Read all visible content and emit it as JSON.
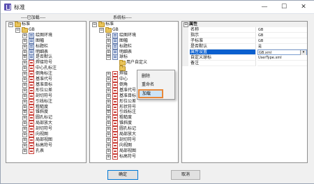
{
  "window": {
    "title": "标准",
    "min": "—",
    "max": "☐",
    "close": "✕"
  },
  "sections": {
    "loaded": "----已加载----",
    "system": "系统标----"
  },
  "loaded_tree": [
    {
      "label": "标准",
      "expander": "⊟",
      "icon": "folder"
    },
    {
      "label": "GB",
      "expander": "⊟",
      "icon": "folder"
    },
    {
      "label": "绘图环境",
      "expander": "⊞",
      "icon": "std"
    },
    {
      "label": "图幅",
      "expander": "⊞",
      "icon": "std"
    },
    {
      "label": "标题栏",
      "expander": "⊞",
      "icon": "std"
    },
    {
      "label": "明细表",
      "expander": "⊞",
      "icon": "std"
    },
    {
      "label": "是否默认",
      "expander": "⊞",
      "icon": "std"
    },
    {
      "label": "焊接符号",
      "expander": "⊞",
      "icon": "red"
    },
    {
      "label": "中心孔标注",
      "expander": "⊞",
      "icon": "red"
    },
    {
      "label": "倒角标注",
      "expander": "⊞",
      "icon": "red"
    },
    {
      "label": "基准代号",
      "expander": "⊞",
      "icon": "red"
    },
    {
      "label": "基准目标",
      "expander": "⊞",
      "icon": "red"
    },
    {
      "label": "形位公差",
      "expander": "⊞",
      "icon": "red"
    },
    {
      "label": "剖切符号",
      "expander": "⊞",
      "icon": "red"
    },
    {
      "label": "引线标注",
      "expander": "⊞",
      "icon": "red"
    },
    {
      "label": "粗糙度",
      "expander": "⊞",
      "icon": "red"
    },
    {
      "label": "锥斜度",
      "expander": "⊞",
      "icon": "red"
    },
    {
      "label": "圆孔标记",
      "expander": "⊞",
      "icon": "red"
    },
    {
      "label": "局部放大",
      "expander": "⊞",
      "icon": "red"
    },
    {
      "label": "剖切符号",
      "expander": "⊞",
      "icon": "red"
    },
    {
      "label": "向视图",
      "expander": "⊞",
      "icon": "red"
    },
    {
      "label": "局部视图",
      "expander": "⊞",
      "icon": "red"
    },
    {
      "label": "标高符号",
      "expander": "⊞",
      "icon": "red"
    },
    {
      "label": "孔表",
      "expander": "⊞",
      "icon": "red"
    }
  ],
  "system_tree": [
    {
      "label": "标准",
      "expander": "⊟",
      "icon": "folder"
    },
    {
      "label": "GB",
      "expander": "⊟",
      "icon": "folder"
    },
    {
      "label": "绘图环境",
      "expander": "⊞",
      "icon": "std"
    },
    {
      "label": "图幅",
      "expander": "⊞",
      "icon": "std"
    },
    {
      "label": "标题栏",
      "expander": "⊞",
      "icon": "std"
    },
    {
      "label": "明细表",
      "expander": "⊞",
      "icon": "std"
    },
    {
      "label": "球标",
      "expander": "⊟",
      "icon": "std"
    },
    {
      "label": "用户自定义",
      "expander": "",
      "icon": "folder"
    },
    {
      "label": "",
      "expander": "",
      "icon": "folder"
    },
    {
      "label": "焊接",
      "expander": "⊞",
      "icon": "red"
    },
    {
      "label": "中心",
      "expander": "⊞",
      "icon": "red"
    },
    {
      "label": "倒角",
      "expander": "⊞",
      "icon": "red"
    },
    {
      "label": "基准代号",
      "expander": "⊞",
      "icon": "red"
    },
    {
      "label": "基准目标",
      "expander": "⊞",
      "icon": "red"
    },
    {
      "label": "形位公差",
      "expander": "⊞",
      "icon": "red"
    },
    {
      "label": "形状符号",
      "expander": "⊞",
      "icon": "red"
    },
    {
      "label": "引线标注",
      "expander": "⊞",
      "icon": "red"
    },
    {
      "label": "粗糙度",
      "expander": "⊞",
      "icon": "red"
    },
    {
      "label": "锥斜度",
      "expander": "⊞",
      "icon": "red"
    },
    {
      "label": "圆孔标记",
      "expander": "⊞",
      "icon": "red"
    },
    {
      "label": "局部放大",
      "expander": "⊞",
      "icon": "red"
    },
    {
      "label": "剖切符号",
      "expander": "⊞",
      "icon": "red"
    },
    {
      "label": "向视图",
      "expander": "⊞",
      "icon": "red"
    },
    {
      "label": "局部视图",
      "expander": "⊞",
      "icon": "red"
    },
    {
      "label": "标高符号",
      "expander": "⊞",
      "icon": "red"
    }
  ],
  "context_menu": [
    {
      "label": "删除",
      "active": false
    },
    {
      "label": "重命名",
      "active": false
    },
    {
      "label": "加载",
      "active": true
    }
  ],
  "properties": {
    "toggle": "⊟",
    "header": "属性",
    "rows": [
      {
        "key": "名称",
        "value": "GB",
        "selected": false
      },
      {
        "key": "指示",
        "value": "GB",
        "selected": false
      },
      {
        "key": "子标准",
        "value": "GB",
        "selected": false
      },
      {
        "key": "是否默认",
        "value": "是",
        "selected": false
      },
      {
        "key": "属性设置",
        "value": "GB.xml",
        "selected": true
      },
      {
        "key": "自定义球标",
        "value": "UserType.xml",
        "selected": false
      },
      {
        "key": "备注",
        "value": "",
        "selected": false
      }
    ],
    "dropdown_glyph": "▾"
  },
  "buttons": {
    "ok": "确定",
    "cancel": "取消"
  }
}
